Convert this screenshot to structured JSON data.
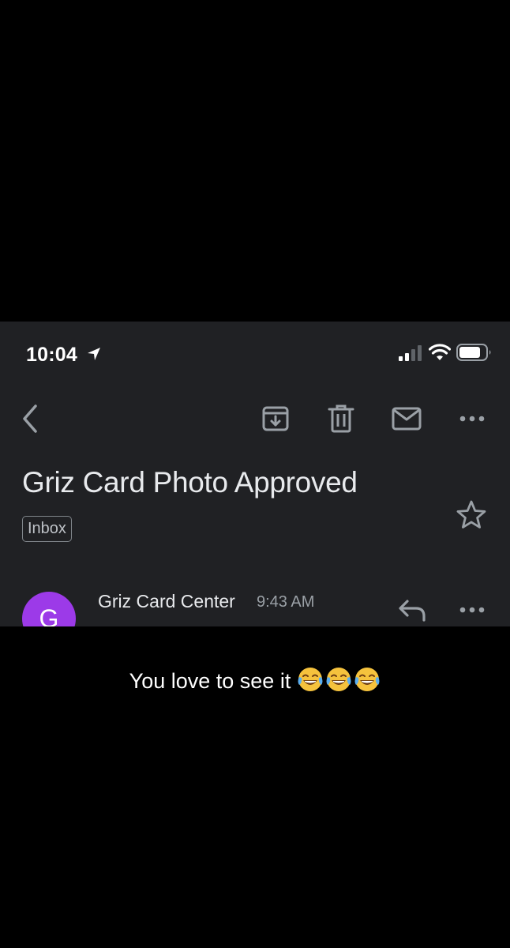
{
  "status_bar": {
    "time": "10:04",
    "location_icon": "location-arrow-icon",
    "signal_icon": "cellular-signal-icon",
    "wifi_icon": "wifi-icon",
    "battery_icon": "battery-icon"
  },
  "toolbar": {
    "back_icon": "chevron-left-icon",
    "archive_icon": "archive-icon",
    "delete_icon": "trash-icon",
    "mark_unread_icon": "mail-icon",
    "more_icon": "more-horizontal-icon"
  },
  "email": {
    "subject": "Griz Card Photo Approved",
    "label": "Inbox",
    "star_icon": "star-outline-icon",
    "sender": {
      "avatar_letter": "G",
      "avatar_color": "#9c3ae8",
      "name": "Griz Card Center",
      "time": "9:43 AM"
    },
    "reply_icon": "reply-icon",
    "message_more_icon": "more-horizontal-icon"
  },
  "caption": {
    "text": "You love to see it",
    "emoji_icon": "tears-of-joy-emoji"
  },
  "colors": {
    "background": "#000000",
    "app_background": "#202124",
    "primary_text": "#e8eaed",
    "secondary_text": "#9aa0a6",
    "icon": "#9aa0a6"
  }
}
